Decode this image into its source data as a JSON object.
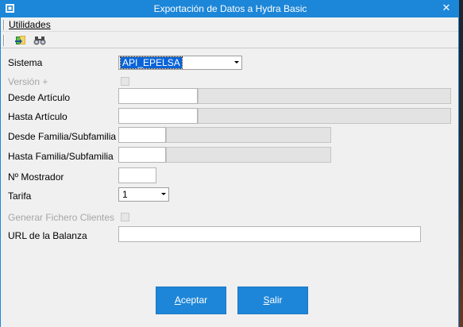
{
  "window": {
    "title": "Exportación de Datos a Hydra Basic",
    "close_glyph": "✕"
  },
  "menu": {
    "utilidades": "Utilidades"
  },
  "toolbar": {
    "export_icon": "export-icon",
    "binoculars_icon": "binoculars-icon"
  },
  "form": {
    "sistema": {
      "label": "Sistema",
      "value": "API_EPELSA"
    },
    "version": {
      "label": "Versión +",
      "checked": false
    },
    "desde_articulo": {
      "label": "Desde Artículo",
      "value": ""
    },
    "hasta_articulo": {
      "label": "Hasta Artículo",
      "value": ""
    },
    "desde_familia": {
      "label": "Desde Familia/Subfamilia",
      "value": ""
    },
    "hasta_familia": {
      "label": "Hasta Familia/Subfamilia",
      "value": ""
    },
    "mostrador": {
      "label": "Nº Mostrador",
      "value": ""
    },
    "tarifa": {
      "label": "Tarifa",
      "value": "1"
    },
    "generar_clientes": {
      "label": "Generar Fichero Clientes",
      "checked": false
    },
    "url_balanza": {
      "label": "URL de la Balanza",
      "value": ""
    }
  },
  "buttons": {
    "aceptar": {
      "first": "A",
      "rest": "ceptar"
    },
    "salir": {
      "first": "S",
      "rest": "alir"
    }
  },
  "colors": {
    "accent": "#1c86d8",
    "selection": "#0a64d8"
  }
}
